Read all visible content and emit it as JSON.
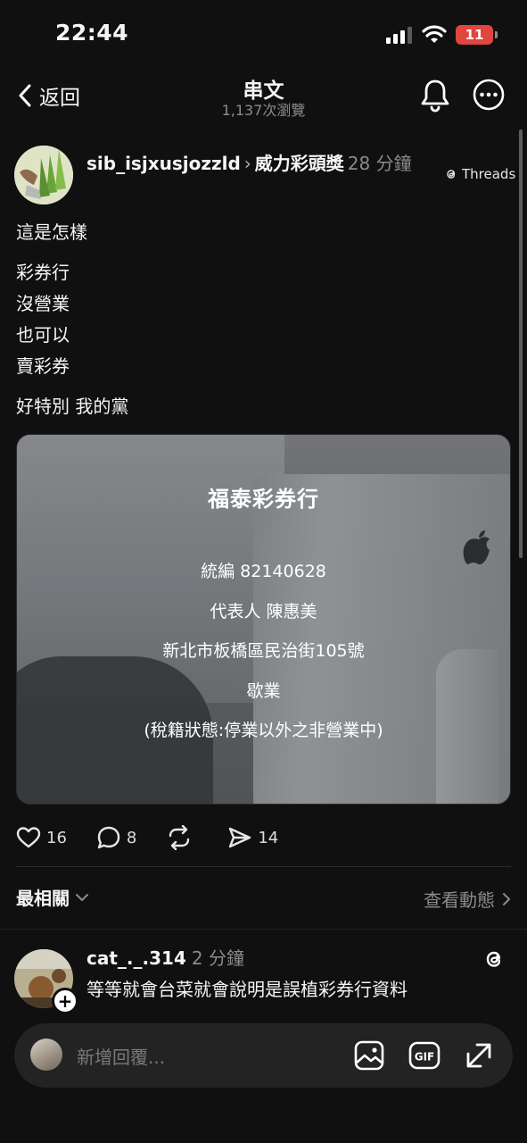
{
  "status_bar": {
    "time": "22:44",
    "battery": "11",
    "battery_color": "#e0463f"
  },
  "nav": {
    "back_label": "返回",
    "title": "串文",
    "views": "1,137次瀏覽"
  },
  "post": {
    "username": "sib_isjxusjozzld",
    "topic": "威力彩頭獎",
    "time": "28 分鐘",
    "badge": "Threads",
    "body": {
      "line1": "這是怎樣",
      "line2": "彩券行",
      "line3": "沒營業",
      "line4": "也可以",
      "line5": "賣彩券",
      "line6": "好特別 我的黨"
    },
    "image": {
      "title": "福泰彩券行",
      "tax_id": "統編 82140628",
      "representative": "代表人 陳惠美",
      "address": "新北市板橋區民治街105號",
      "status": "歇業",
      "tax_status": "(稅籍狀態:停業以外之非營業中)"
    },
    "actions": {
      "likes": "16",
      "comments": "8",
      "reposts": "",
      "shares": "14"
    }
  },
  "replies_bar": {
    "sort_label": "最相關",
    "see_activity": "查看動態"
  },
  "reply": {
    "username": "cat_._.314",
    "time": "2 分鐘",
    "text": "等等就會台菜就會說明是誤植彩券行資料"
  },
  "composer": {
    "placeholder": "新增回覆..."
  }
}
